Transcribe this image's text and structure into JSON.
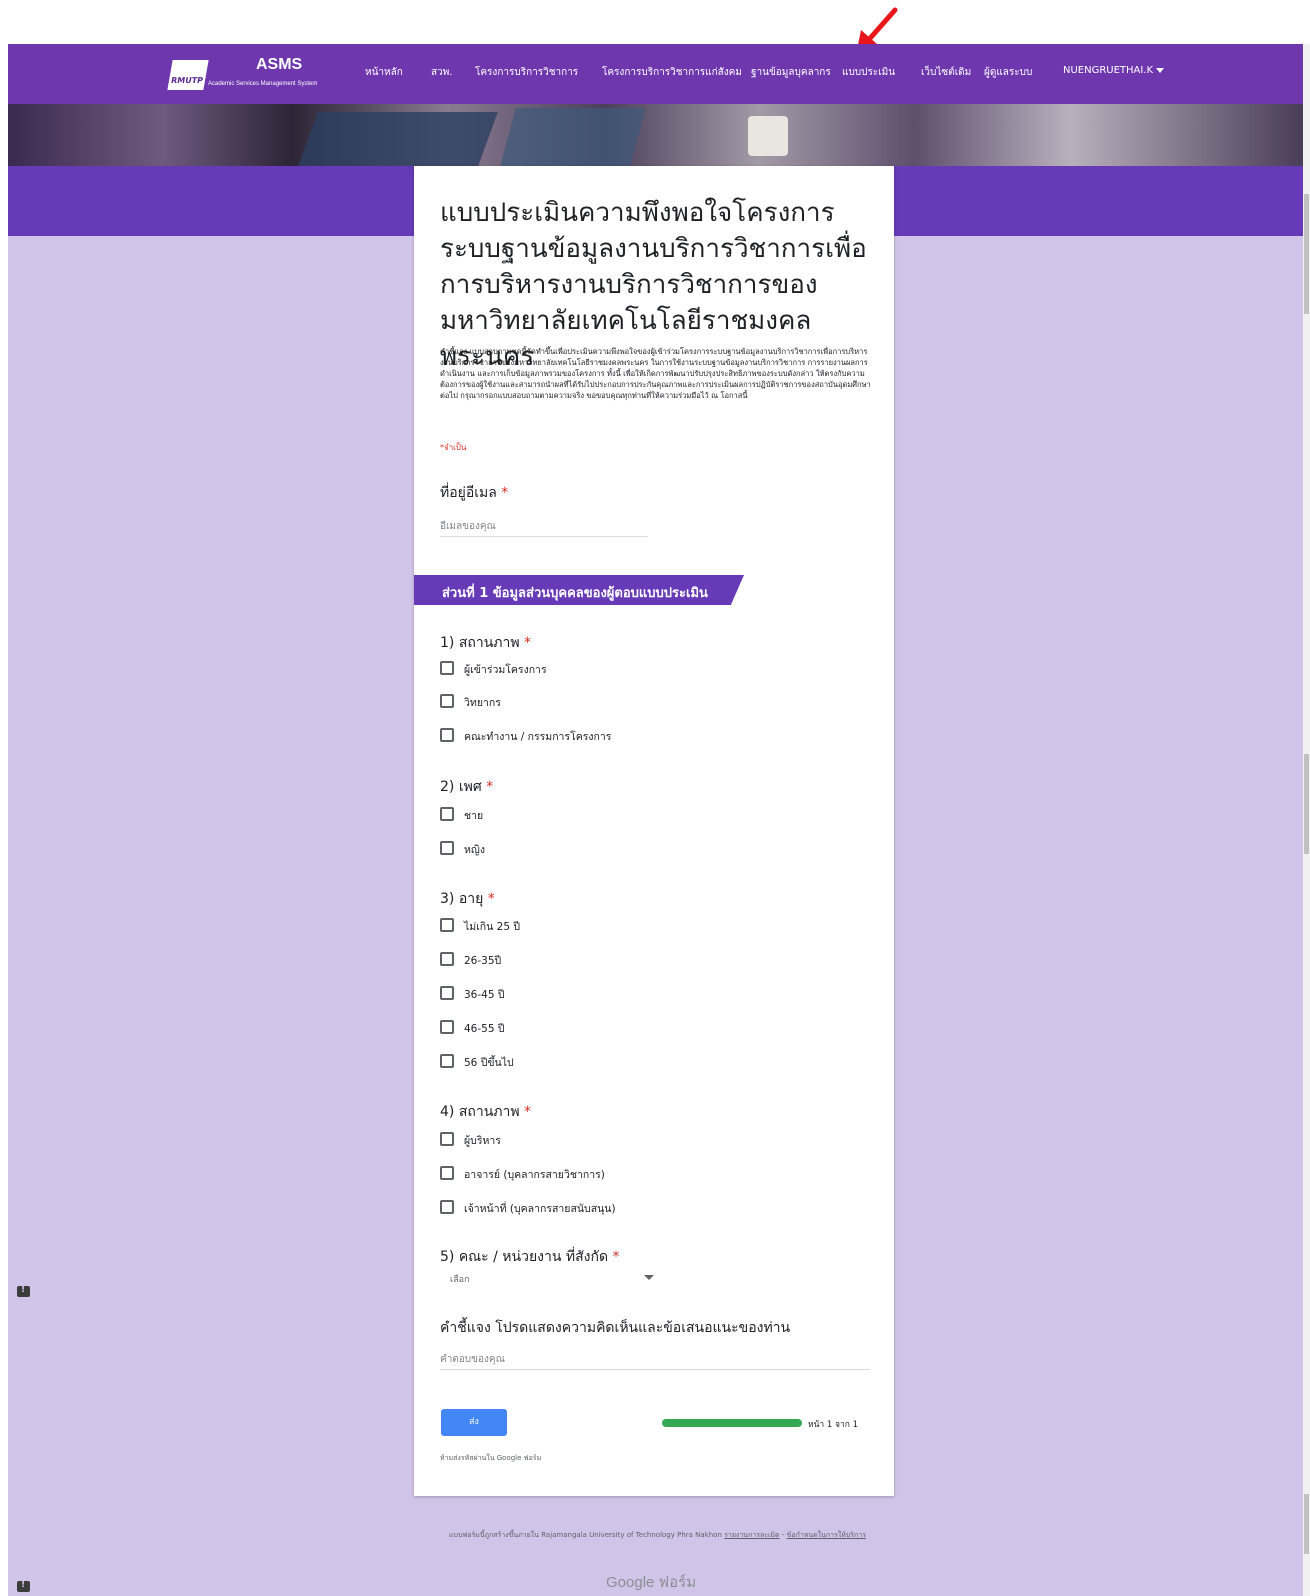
{
  "header": {
    "logo_mark": "RMUTP",
    "logo_title": "ASMS",
    "logo_subtitle": "Academic Services Management System",
    "nav_items": [
      "หน้าหลัก",
      "สวพ.",
      "โครงการบริการวิชาการ",
      "โครงการบริการวิชาการแก่สังคม",
      "ฐานข้อมูลบุคลากร",
      "แบบประเมิน",
      "เว็บไซต์เดิม",
      "ผู้ดูแลระบบ",
      "NUENGRUETHAI.K"
    ],
    "highlighted_item": "แบบประเมิน"
  },
  "form": {
    "title": "แบบประเมินความพึงพอใจโครงการระบบฐานข้อมูลงานบริการวิชาการเพื่อการบริหารงานบริการวิชาการของมหาวิทยาลัยเทคโนโลยีราชมงคลพระนคร",
    "description": "คำชี้แจง แบบสอบถามชุดนี้จัดทำขึ้นเพื่อประเมินความพึงพอใจของผู้เข้าร่วมโครงการระบบฐานข้อมูลงานบริการวิชาการเพื่อการบริหารงานบริการวิชาการของมหาวิทยาลัยเทคโนโลยีราชมงคลพระนคร ในการใช้งานระบบฐานข้อมูลงานบริการวิชาการ การรายงานผลการดำเนินงาน และการเก็บข้อมูลภาพรวมของโครงการ ทั้งนี้ เพื่อให้เกิดการพัฒนาปรับปรุงประสิทธิภาพของระบบดังกล่าว ให้ตรงกับความต้องการของผู้ใช้งานและสามารถนำผลที่ได้รับไปประกอบการประกันคุณภาพและการประเมินผลการปฏิบัติราชการของสถาบันอุดมศึกษาต่อไป กรุณากรอกแบบสอบถามตามความจริง ขอขอบคุณทุกท่านที่ให้ความร่วมมือไว้ ณ โอกาสนี้",
    "required_note": "*จำเป็น",
    "email": {
      "label": "ที่อยู่อีเมล",
      "placeholder": "อีเมลของคุณ"
    },
    "section1_title": "ส่วนที่ 1 ข้อมูลส่วนบุคคลของผู้ตอบแบบประเมิน",
    "q1": {
      "label": "1) สถานภาพ",
      "options": [
        "ผู้เข้าร่วมโครงการ",
        "วิทยากร",
        "คณะทำงาน / กรรมการโครงการ"
      ]
    },
    "q2": {
      "label": "2) เพศ",
      "options": [
        "ชาย",
        "หญิง"
      ]
    },
    "q3": {
      "label": "3) อายุ",
      "options": [
        "ไม่เกิน 25 ปี",
        "26-35ปี",
        "36-45 ปี",
        "46-55 ปี",
        "56 ปีขึ้นไป"
      ]
    },
    "q4": {
      "label": "4) สถานภาพ",
      "options": [
        "ผู้บริหาร",
        "อาจารย์ (บุคลากรสายวิชาการ)",
        "เจ้าหน้าที่ (บุคลากรสายสนับสนุน)"
      ]
    },
    "q5": {
      "label": "5) คณะ / หน่วยงาน ที่สังกัด",
      "select_value": "เลือก"
    },
    "q6": {
      "label": "คำชี้แจง โปรดแสดงความคิดเห็นและข้อเสนอแนะของท่าน",
      "placeholder": "คำตอบของคุณ"
    },
    "required_star": "*",
    "submit_label": "ส่ง",
    "progress_fraction": 1.0,
    "page_indicator": "หน้า 1 จาก 1",
    "never_submit": "ห้ามส่งรหัสผ่านใน Google ฟอร์ม"
  },
  "footer": {
    "text": "แบบฟอร์มนี้ถูกสร้างขึ้นภายใน Rajamangala University of Technology Phra Nakhon",
    "report_link": "รายงานการละเมิด",
    "separator": " - ",
    "terms_link": "ข้อกำหนดในการให้บริการ",
    "brand_google": "Google",
    "brand_forms": "ฟอร์ม"
  },
  "colors": {
    "brand_purple": "#673ab7",
    "form_bg": "#d1c4e9",
    "submit_blue": "#4285f4",
    "progress_green": "#34a853",
    "required_red": "#d93025",
    "annotation_arrow": "#e8161b"
  },
  "icons": [
    "feedback-icon",
    "red-arrow-annotation-icon",
    "dropdown-caret-icon",
    "select-arrow-icon"
  ]
}
